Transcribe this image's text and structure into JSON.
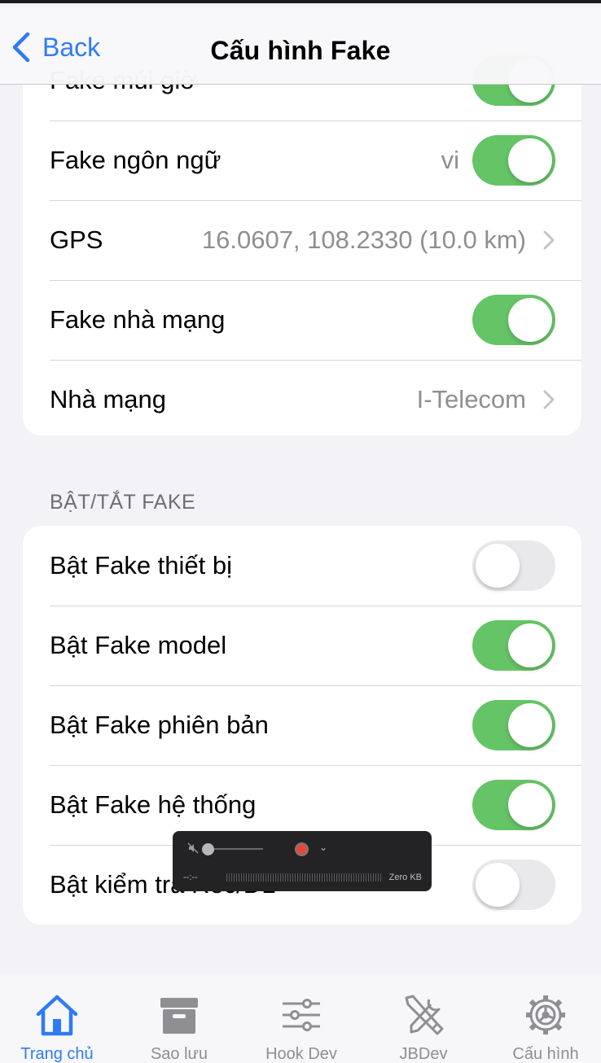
{
  "nav": {
    "back_label": "Back",
    "title": "Cấu hình Fake"
  },
  "card1": {
    "partial_row_label": "Fake múi giờ",
    "partial_row_toggle": true,
    "rows": [
      {
        "label": "Fake ngôn ngữ",
        "value": "vi",
        "toggle": true
      },
      {
        "label": "GPS",
        "value": "16.0607, 108.2330 (10.0 km)",
        "chevron": true
      },
      {
        "label": "Fake nhà mạng",
        "toggle": true
      },
      {
        "label": "Nhà mạng",
        "value": "I-Telecom",
        "chevron": true
      }
    ]
  },
  "section_header": "BẬT/TẮT FAKE",
  "card2": {
    "rows": [
      {
        "label": "Bật Fake thiết bị",
        "toggle": false
      },
      {
        "label": "Bật Fake model",
        "toggle": true
      },
      {
        "label": "Bật Fake phiên bản",
        "toggle": true
      },
      {
        "label": "Bật Fake hệ thống",
        "toggle": true
      },
      {
        "label": "Bật kiểm tra Rec/DL",
        "toggle": false
      }
    ]
  },
  "recorder": {
    "time": "--:--",
    "size": "Zero KB"
  },
  "tabs": [
    {
      "label": "Trang chủ",
      "icon": "home-icon",
      "active": true
    },
    {
      "label": "Sao lưu",
      "icon": "archive-icon",
      "active": false
    },
    {
      "label": "Hook Dev",
      "icon": "sliders-icon",
      "active": false
    },
    {
      "label": "JBDev",
      "icon": "tools-icon",
      "active": false
    },
    {
      "label": "Cấu hình",
      "icon": "gear-icon",
      "active": false
    }
  ],
  "colors": {
    "accent": "#2f7bf5",
    "toggle_on": "#65c466",
    "toggle_off": "#e9e9eb",
    "background": "#f2f2f7"
  }
}
